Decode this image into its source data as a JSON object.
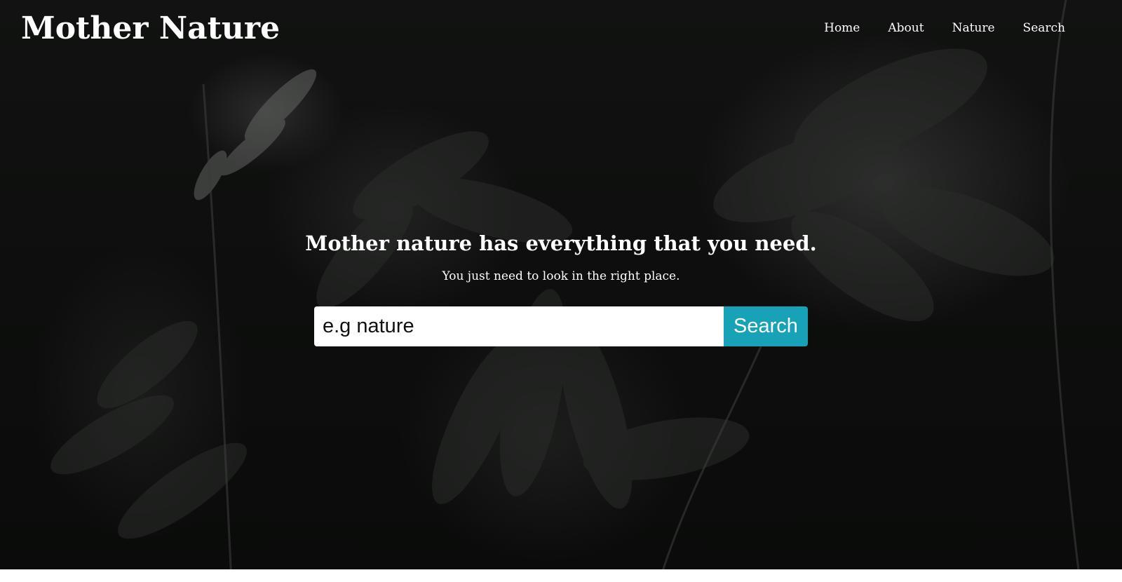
{
  "header": {
    "logo": "Mother Nature",
    "nav": [
      {
        "label": "Home"
      },
      {
        "label": "About"
      },
      {
        "label": "Nature"
      },
      {
        "label": "Search"
      }
    ]
  },
  "hero": {
    "title": "Mother nature has everything that you need.",
    "subtitle": "You just need to look in the right place."
  },
  "search": {
    "placeholder": "e.g nature",
    "value": "",
    "button_label": "Search"
  },
  "colors": {
    "accent": "#17a2b8",
    "background": "#0c0d0c",
    "text": "#ffffff"
  }
}
